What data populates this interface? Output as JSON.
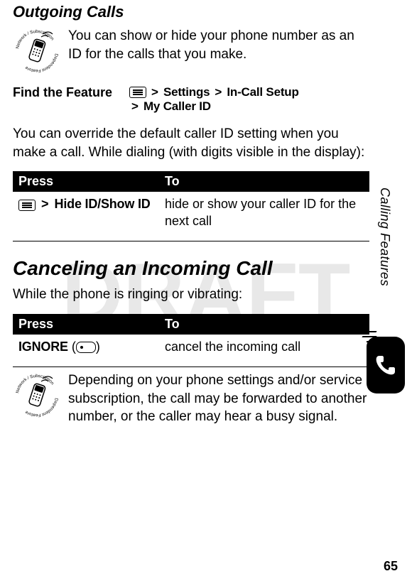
{
  "watermark": "DRAFT",
  "side_tab": "Calling Features",
  "page_number": "65",
  "section1": {
    "title": "Outgoing Calls",
    "intro": "You can show or hide your phone number as an ID for the calls that you make.",
    "fff_label": "Find the Feature",
    "path_line1_a": "Settings",
    "path_line1_b": "In-Call Setup",
    "path_line2": "My Caller ID",
    "override": "You can override the default caller ID setting when you make a call. While dialing (with digits visible in the display):"
  },
  "table1": {
    "head_press": "Press",
    "head_to": "To",
    "press_item": "Hide ID/Show ID",
    "to_item": "hide or show your caller ID for the next call"
  },
  "section2": {
    "title": "Canceling an Incoming Call",
    "intro": "While the phone is ringing or vibrating:"
  },
  "table2": {
    "head_press": "Press",
    "head_to": "To",
    "press_item": "IGNORE",
    "to_item": "cancel the incoming call"
  },
  "note": "Depending on your phone settings and/or service subscription, the call may be forwarded to another number, or the caller may hear a busy signal.",
  "gt": ">",
  "open_paren": "(",
  "close_paren": ")"
}
